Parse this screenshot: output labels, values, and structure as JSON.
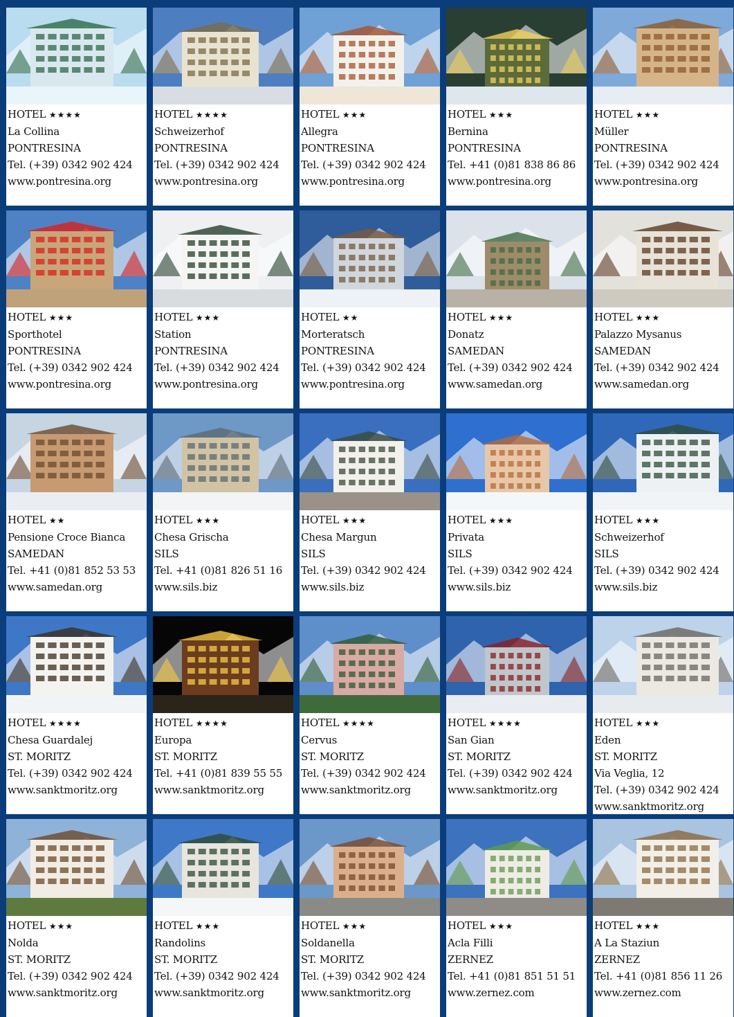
{
  "hotels": [
    {
      "category": "HOTEL",
      "stars": "★★★★",
      "name": "La Collina",
      "town": "PONTRESINA",
      "extra": "",
      "tel": "Tel. (+39) 0342 902 424",
      "web": "www.pontresina.org",
      "sky": "#b9dcef",
      "ground": "#eaf5fb",
      "building": "#d9e8ef",
      "accent": "#2f6a4a"
    },
    {
      "category": "HOTEL",
      "stars": "★★★★",
      "name": "Schweizerhof",
      "town": "PONTRESINA",
      "extra": "",
      "tel": "Tel. (+39) 0342 902 424",
      "web": "www.pontresina.org",
      "sky": "#4d7fc0",
      "ground": "#d8dde4",
      "building": "#e9e2cf",
      "accent": "#7a6a4a"
    },
    {
      "category": "HOTEL",
      "stars": "★★★",
      "name": "Allegra",
      "town": "PONTRESINA",
      "extra": "",
      "tel": "Tel. (+39) 0342 902 424",
      "web": "www.pontresina.org",
      "sky": "#6fa0d6",
      "ground": "#efe6d8",
      "building": "#f3f1ec",
      "accent": "#a6542a"
    },
    {
      "category": "HOTEL",
      "stars": "★★★",
      "name": "Bernina",
      "town": "PONTRESINA",
      "extra": "",
      "tel": "Tel. +41 (0)81 838 86 86",
      "web": "www.pontresina.org",
      "sky": "#2a3f33",
      "ground": "#dfe7ee",
      "building": "#5b6b3c",
      "accent": "#f1d15a"
    },
    {
      "category": "HOTEL",
      "stars": "★★★",
      "name": "Müller",
      "town": "PONTRESINA",
      "extra": "",
      "tel": "Tel. (+39) 0342 902 424",
      "web": "www.pontresina.org",
      "sky": "#7ea9d8",
      "ground": "#e6edf3",
      "building": "#d6b48a",
      "accent": "#8b5a2b"
    },
    {
      "category": "HOTEL",
      "stars": "★★★",
      "name": "Sporthotel",
      "town": "PONTRESINA",
      "extra": "",
      "tel": "Tel. (+39) 0342 902 424",
      "web": "www.pontresina.org",
      "sky": "#4f82c4",
      "ground": "#bfa27a",
      "building": "#c9a67a",
      "accent": "#d8211e"
    },
    {
      "category": "HOTEL",
      "stars": "★★★",
      "name": "Station",
      "town": "PONTRESINA",
      "extra": "",
      "tel": "Tel. (+39) 0342 902 424",
      "web": "www.pontresina.org",
      "sky": "#eef0f2",
      "ground": "#d9dcdf",
      "building": "#f5f5f3",
      "accent": "#24402a"
    },
    {
      "category": "HOTEL",
      "stars": "★★",
      "name": "Morteratsch",
      "town": "PONTRESINA",
      "extra": "",
      "tel": "Tel. (+39) 0342 902 424",
      "web": "www.pontresina.org",
      "sky": "#2f5c9a",
      "ground": "#eef2f6",
      "building": "#cfd6de",
      "accent": "#7a5a3a"
    },
    {
      "category": "HOTEL",
      "stars": "★★★",
      "name": "Donatz",
      "town": "SAMEDAN",
      "extra": "",
      "tel": "Tel. (+39) 0342 902 424",
      "web": "www.samedan.org",
      "sky": "#dbe2ea",
      "ground": "#b8b1a6",
      "building": "#9e8b6a",
      "accent": "#3d6a43"
    },
    {
      "category": "HOTEL",
      "stars": "★★★",
      "name": "Palazzo Mysanus",
      "town": "SAMEDAN",
      "extra": "",
      "tel": "Tel. (+39) 0342 902 424",
      "web": "www.samedan.org",
      "sky": "#e3e1dc",
      "ground": "#cfcac0",
      "building": "#e8e3d8",
      "accent": "#5b3a22"
    },
    {
      "category": "HOTEL",
      "stars": "★★",
      "name": "Pensione Croce Bianca",
      "town": "SAMEDAN",
      "extra": "",
      "tel": "Tel. +41 (0)81 852 53 53",
      "web": "www.samedan.org",
      "sky": "#c7d5e3",
      "ground": "#eaeef2",
      "building": "#c79a72",
      "accent": "#6b4a2e"
    },
    {
      "category": "HOTEL",
      "stars": "★★★",
      "name": "Chesa Grischa",
      "town": "SILS",
      "extra": "",
      "tel": "Tel. +41 (0)81 826 51 16",
      "web": "www.sils.biz",
      "sky": "#6e98c6",
      "ground": "#f2f4f6",
      "building": "#d2c3a5",
      "accent": "#5a6b73"
    },
    {
      "category": "HOTEL",
      "stars": "★★★",
      "name": "Chesa Margun",
      "town": "SILS",
      "extra": "",
      "tel": "Tel. (+39) 0342 902 424",
      "web": "www.sils.biz",
      "sky": "#3a6fbf",
      "ground": "#9a9288",
      "building": "#f2f0ea",
      "accent": "#3b4a3a"
    },
    {
      "category": "HOTEL",
      "stars": "★★★",
      "name": "Privata",
      "town": "SILS",
      "extra": "",
      "tel": "Tel. (+39) 0342 902 424",
      "web": "www.sils.biz",
      "sky": "#2f6fd0",
      "ground": "#f4f7fa",
      "building": "#e7c7a8",
      "accent": "#b76a3a"
    },
    {
      "category": "HOTEL",
      "stars": "★★★",
      "name": "Schweizerhof",
      "town": "SILS",
      "extra": "",
      "tel": "Tel. (+39) 0342 902 424",
      "web": "www.sils.biz",
      "sky": "#2f68b8",
      "ground": "#f0f4f7",
      "building": "#eef1f3",
      "accent": "#2e4b3a"
    },
    {
      "category": "HOTEL",
      "stars": "★★★★",
      "name": "Chesa Guardalej",
      "town": "ST. MORITZ",
      "extra": "",
      "tel": "Tel. (+39) 0342 902 424",
      "web": "www.sanktmoritz.org",
      "sky": "#3e77c6",
      "ground": "#f1f4f7",
      "building": "#f4f3ef",
      "accent": "#3a2e22"
    },
    {
      "category": "HOTEL",
      "stars": "★★★★",
      "name": "Europa",
      "town": "ST. MORITZ",
      "extra": "",
      "tel": "Tel. +41 (0)81 839 55 55",
      "web": "www.sanktmoritz.org",
      "sky": "#060606",
      "ground": "#2b2419",
      "building": "#6b3c1f",
      "accent": "#f6c944"
    },
    {
      "category": "HOTEL",
      "stars": "★★★★",
      "name": "Cervus",
      "town": "ST. MORITZ",
      "extra": "",
      "tel": "Tel. (+39) 0342 902 424",
      "web": "www.sanktmoritz.org",
      "sky": "#5f8fcb",
      "ground": "#3f6b3a",
      "building": "#d9a9a4",
      "accent": "#2e5a30"
    },
    {
      "category": "HOTEL",
      "stars": "★★★★",
      "name": "San Gian",
      "town": "ST. MORITZ",
      "extra": "",
      "tel": "Tel. (+39) 0342 902 424",
      "web": "www.sanktmoritz.org",
      "sky": "#2f63ad",
      "ground": "#e9edf1",
      "building": "#bfc6cc",
      "accent": "#8b1e1e"
    },
    {
      "category": "HOTEL",
      "stars": "★★★",
      "name": "Eden",
      "town": "ST. MORITZ",
      "extra": "Via Veglia, 12",
      "tel": "Tel. (+39) 0342 902 424",
      "web": "www.sanktmoritz.org",
      "sky": "#bcd3ea",
      "ground": "#e7ebee",
      "building": "#ece9e2",
      "accent": "#6a665f"
    },
    {
      "category": "HOTEL",
      "stars": "★★★",
      "name": "Nolda",
      "town": "ST. MORITZ",
      "extra": "",
      "tel": "Tel. (+39) 0342 902 424",
      "web": "www.sanktmoritz.org",
      "sky": "#8fb2d8",
      "ground": "#5f7a3e",
      "building": "#f1ede4",
      "accent": "#6b4a2a"
    },
    {
      "category": "HOTEL",
      "stars": "★★★",
      "name": "Randolins",
      "town": "ST. MORITZ",
      "extra": "",
      "tel": "Tel. (+39) 0342 902 424",
      "web": "www.sanktmoritz.org",
      "sky": "#3f78c6",
      "ground": "#f4f6f8",
      "building": "#e8e5de",
      "accent": "#2e4a33"
    },
    {
      "category": "HOTEL",
      "stars": "★★★",
      "name": "Soldanella",
      "town": "ST. MORITZ",
      "extra": "",
      "tel": "Tel. (+39) 0342 902 424",
      "web": "www.sanktmoritz.org",
      "sky": "#6c97c9",
      "ground": "#8a8a86",
      "building": "#d9b08b",
      "accent": "#7a4a2a"
    },
    {
      "category": "HOTEL",
      "stars": "★★★",
      "name": "Acla Filli",
      "town": "ZERNEZ",
      "extra": "",
      "tel": "Tel. +41 (0)81 851 51 51",
      "web": "www.zernez.com",
      "sky": "#3c72be",
      "ground": "#8f8c87",
      "building": "#efece6",
      "accent": "#5f9a48"
    },
    {
      "category": "HOTEL",
      "stars": "★★★",
      "name": "A La Staziun",
      "town": "ZERNEZ",
      "extra": "",
      "tel": "Tel. +41 (0)81 856 11 26",
      "web": "www.zernez.com",
      "sky": "#a8c4e0",
      "ground": "#7e7a72",
      "building": "#f2efe8",
      "accent": "#8a6a3f"
    }
  ]
}
